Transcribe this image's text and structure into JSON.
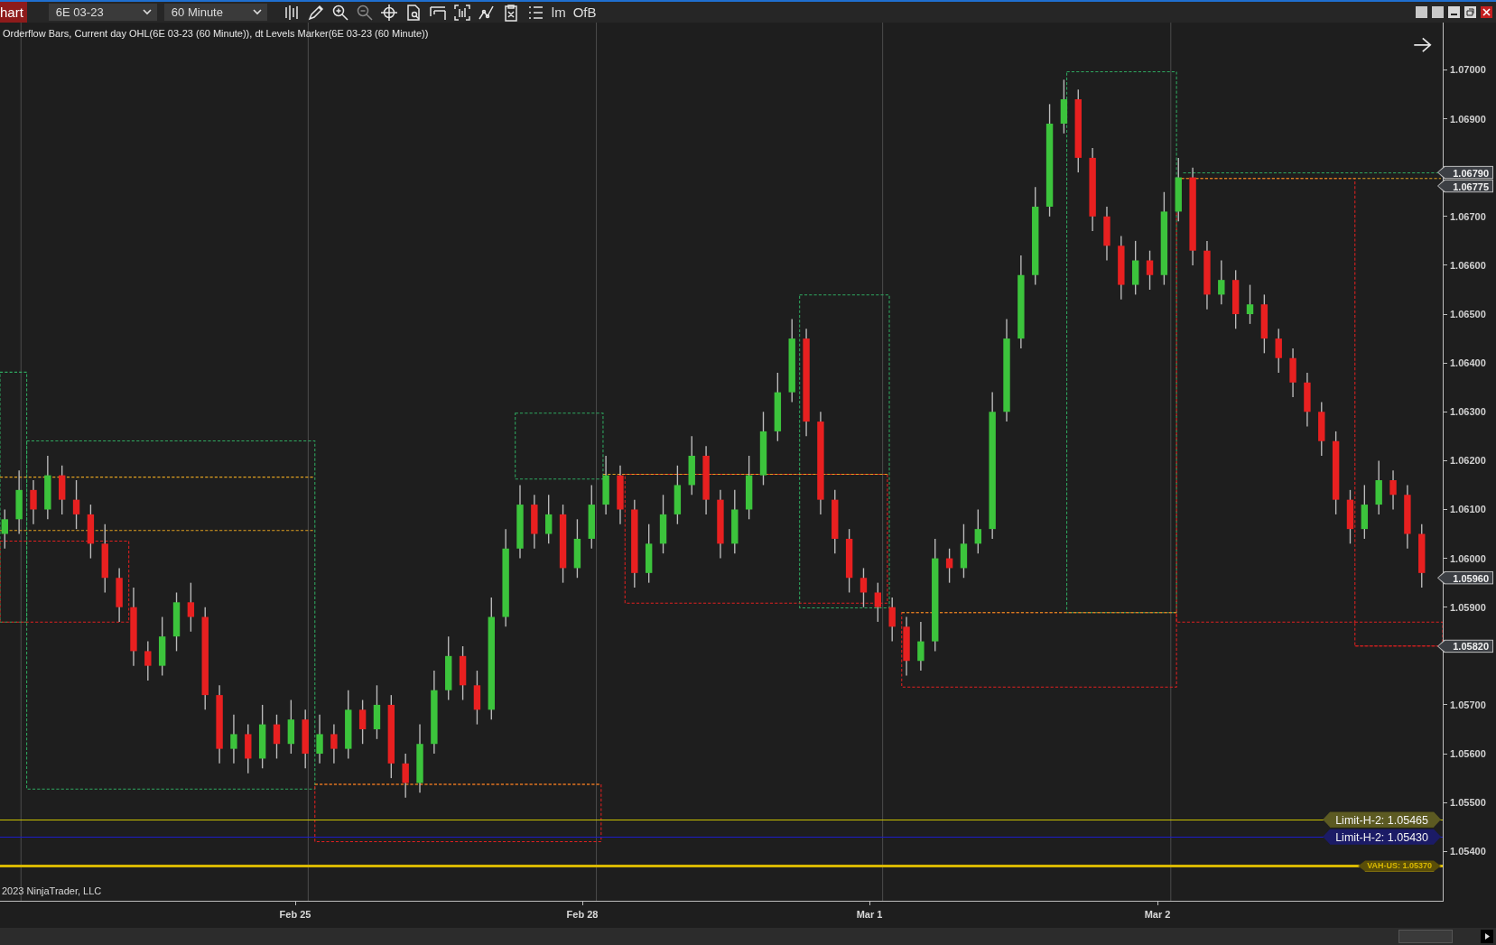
{
  "toolbar": {
    "tab_label": "hart",
    "instrument": {
      "value": "6E 03-23"
    },
    "interval": {
      "value": "60 Minute"
    },
    "text_tools": [
      "lm",
      "OfB"
    ]
  },
  "chart": {
    "title": "Orderflow Bars, Current day OHL(6E 03-23 (60 Minute)), dt Levels Marker(6E 03-23 (60 Minute))",
    "copyright": "2023 NinjaTrader, LLC",
    "price_markers": [
      {
        "label": "1.06790"
      },
      {
        "label": "1.06775"
      },
      {
        "label": "1.05960"
      },
      {
        "label": "1.05820"
      }
    ],
    "date_labels": [
      "Feb 25",
      "Feb 28",
      "Mar 1",
      "Mar 2"
    ],
    "level_lines": [
      {
        "label": "Limit-H-2: 1.05465",
        "color": "#c9c100",
        "kind": "limit"
      },
      {
        "label": "Limit-H-2: 1.05430",
        "color": "#1c1cc8",
        "kind": "limit"
      },
      {
        "label": "VAH-US: 1.05370",
        "color": "#d9b800",
        "kind": "value-area"
      }
    ],
    "chart_data": {
      "type": "candlestick",
      "ylim": [
        1.05297,
        1.07097
      ],
      "yticks": [
        {
          "value": 1.07,
          "label": "1.07000"
        },
        {
          "value": 1.069,
          "label": "1.06900"
        },
        {
          "value": 1.067,
          "label": "1.06700"
        },
        {
          "value": 1.066,
          "label": "1.06600"
        },
        {
          "value": 1.065,
          "label": "1.06500"
        },
        {
          "value": 1.064,
          "label": "1.06400"
        },
        {
          "value": 1.063,
          "label": "1.06300"
        },
        {
          "value": 1.062,
          "label": "1.06200"
        },
        {
          "value": 1.061,
          "label": "1.06100"
        },
        {
          "value": 1.06,
          "label": "1.06000"
        },
        {
          "value": 1.059,
          "label": "1.05900"
        },
        {
          "value": 1.057,
          "label": "1.05700"
        },
        {
          "value": 1.056,
          "label": "1.05600"
        },
        {
          "value": 1.055,
          "label": "1.05500"
        },
        {
          "value": 1.054,
          "label": "1.05400"
        }
      ],
      "categories": [
        null,
        null,
        null,
        null,
        null,
        null,
        null,
        null,
        null,
        null,
        null,
        null,
        null,
        null,
        null,
        null,
        null,
        null,
        null,
        null,
        null,
        null,
        null,
        null,
        null,
        null,
        null,
        null,
        null,
        null,
        null,
        null,
        null,
        null,
        null,
        null,
        null,
        null,
        null,
        null,
        null,
        null,
        null,
        null,
        null,
        null,
        null,
        null,
        null,
        null,
        null,
        null,
        null,
        null,
        null,
        null,
        null,
        null,
        null,
        null,
        null,
        null,
        null,
        null,
        null,
        null,
        null,
        null,
        null,
        null,
        null,
        null,
        null,
        null,
        null,
        null,
        null,
        null,
        null,
        null,
        null,
        null,
        null,
        null,
        null,
        null,
        null,
        null,
        null,
        null,
        null,
        null,
        null,
        null,
        null,
        null,
        null,
        null,
        null,
        null
      ],
      "ohlc": [
        [
          1.0605,
          1.061,
          1.0602,
          1.0608
        ],
        [
          1.0608,
          1.0618,
          1.0605,
          1.0614
        ],
        [
          1.0614,
          1.0616,
          1.0607,
          1.061
        ],
        [
          1.061,
          1.0621,
          1.0608,
          1.0617
        ],
        [
          1.0617,
          1.0619,
          1.0609,
          1.0612
        ],
        [
          1.0612,
          1.0616,
          1.0606,
          1.0609
        ],
        [
          1.0609,
          1.0611,
          1.06,
          1.0603
        ],
        [
          1.0603,
          1.0607,
          1.0593,
          1.0596
        ],
        [
          1.0596,
          1.0598,
          1.0587,
          1.059
        ],
        [
          1.059,
          1.0594,
          1.0578,
          1.0581
        ],
        [
          1.0581,
          1.0583,
          1.0575,
          1.0578
        ],
        [
          1.0578,
          1.0588,
          1.0576,
          1.0584
        ],
        [
          1.0584,
          1.0593,
          1.0581,
          1.0591
        ],
        [
          1.0591,
          1.0595,
          1.0585,
          1.0588
        ],
        [
          1.0588,
          1.059,
          1.0569,
          1.0572
        ],
        [
          1.0572,
          1.0574,
          1.0558,
          1.0561
        ],
        [
          1.0561,
          1.0568,
          1.0558,
          1.0564
        ],
        [
          1.0564,
          1.0566,
          1.0556,
          1.0559
        ],
        [
          1.0559,
          1.057,
          1.0557,
          1.0566
        ],
        [
          1.0566,
          1.0568,
          1.0559,
          1.0562
        ],
        [
          1.0562,
          1.0571,
          1.056,
          1.0567
        ],
        [
          1.0567,
          1.0569,
          1.0557,
          1.056
        ],
        [
          1.056,
          1.0568,
          1.0558,
          1.0564
        ],
        [
          1.0564,
          1.0566,
          1.0558,
          1.0561
        ],
        [
          1.0561,
          1.0573,
          1.0559,
          1.0569
        ],
        [
          1.0569,
          1.0571,
          1.0562,
          1.0565
        ],
        [
          1.0565,
          1.0574,
          1.0563,
          1.057
        ],
        [
          1.057,
          1.0572,
          1.0555,
          1.0558
        ],
        [
          1.0558,
          1.056,
          1.0551,
          1.0554
        ],
        [
          1.0554,
          1.0566,
          1.0552,
          1.0562
        ],
        [
          1.0562,
          1.0577,
          1.056,
          1.0573
        ],
        [
          1.0573,
          1.0584,
          1.0571,
          1.058
        ],
        [
          1.058,
          1.0582,
          1.0571,
          1.0574
        ],
        [
          1.0574,
          1.0577,
          1.0566,
          1.0569
        ],
        [
          1.0569,
          1.0592,
          1.0567,
          1.0588
        ],
        [
          1.0588,
          1.0606,
          1.0586,
          1.0602
        ],
        [
          1.0602,
          1.0615,
          1.06,
          1.0611
        ],
        [
          1.0611,
          1.0613,
          1.0602,
          1.0605
        ],
        [
          1.0605,
          1.0613,
          1.0603,
          1.0609
        ],
        [
          1.0609,
          1.0611,
          1.0595,
          1.0598
        ],
        [
          1.0598,
          1.0608,
          1.0596,
          1.0604
        ],
        [
          1.0604,
          1.0615,
          1.0602,
          1.0611
        ],
        [
          1.0611,
          1.0621,
          1.0609,
          1.0617
        ],
        [
          1.0617,
          1.0619,
          1.0607,
          1.061
        ],
        [
          1.061,
          1.0612,
          1.0594,
          1.0597
        ],
        [
          1.0597,
          1.0607,
          1.0595,
          1.0603
        ],
        [
          1.0603,
          1.0613,
          1.0601,
          1.0609
        ],
        [
          1.0609,
          1.0619,
          1.0607,
          1.0615
        ],
        [
          1.0615,
          1.0625,
          1.0613,
          1.0621
        ],
        [
          1.0621,
          1.0623,
          1.0609,
          1.0612
        ],
        [
          1.0612,
          1.0614,
          1.06,
          1.0603
        ],
        [
          1.0603,
          1.0614,
          1.0601,
          1.061
        ],
        [
          1.061,
          1.0621,
          1.0608,
          1.0617
        ],
        [
          1.0617,
          1.063,
          1.0615,
          1.0626
        ],
        [
          1.0626,
          1.0638,
          1.0624,
          1.0634
        ],
        [
          1.0634,
          1.0649,
          1.0632,
          1.0645
        ],
        [
          1.0645,
          1.0647,
          1.0625,
          1.0628
        ],
        [
          1.0628,
          1.063,
          1.0609,
          1.0612
        ],
        [
          1.0612,
          1.0614,
          1.0601,
          1.0604
        ],
        [
          1.0604,
          1.0606,
          1.0593,
          1.0596
        ],
        [
          1.0596,
          1.0598,
          1.059,
          1.0593
        ],
        [
          1.0593,
          1.0595,
          1.0587,
          1.059
        ],
        [
          1.059,
          1.0592,
          1.0583,
          1.0586
        ],
        [
          1.0586,
          1.0588,
          1.0576,
          1.0579
        ],
        [
          1.0579,
          1.0587,
          1.0577,
          1.0583
        ],
        [
          1.0583,
          1.0604,
          1.0581,
          1.06
        ],
        [
          1.06,
          1.0602,
          1.0595,
          1.0598
        ],
        [
          1.0598,
          1.0607,
          1.0596,
          1.0603
        ],
        [
          1.0603,
          1.061,
          1.0601,
          1.0606
        ],
        [
          1.0606,
          1.0634,
          1.0604,
          1.063
        ],
        [
          1.063,
          1.0649,
          1.0628,
          1.0645
        ],
        [
          1.0645,
          1.0662,
          1.0643,
          1.0658
        ],
        [
          1.0658,
          1.0676,
          1.0656,
          1.0672
        ],
        [
          1.0672,
          1.0693,
          1.067,
          1.0689
        ],
        [
          1.0689,
          1.0698,
          1.0687,
          1.0694
        ],
        [
          1.0694,
          1.0696,
          1.0679,
          1.0682
        ],
        [
          1.0682,
          1.0684,
          1.0667,
          1.067
        ],
        [
          1.067,
          1.0672,
          1.0661,
          1.0664
        ],
        [
          1.0664,
          1.0666,
          1.0653,
          1.0656
        ],
        [
          1.0656,
          1.0665,
          1.0654,
          1.0661
        ],
        [
          1.0661,
          1.0663,
          1.0655,
          1.0658
        ],
        [
          1.0658,
          1.0675,
          1.0656,
          1.0671
        ],
        [
          1.0671,
          1.0682,
          1.0669,
          1.0678
        ],
        [
          1.0678,
          1.068,
          1.066,
          1.0663
        ],
        [
          1.0663,
          1.0665,
          1.0651,
          1.0654
        ],
        [
          1.0654,
          1.0661,
          1.0652,
          1.0657
        ],
        [
          1.0657,
          1.0659,
          1.0647,
          1.065
        ],
        [
          1.065,
          1.0656,
          1.0648,
          1.0652
        ],
        [
          1.0652,
          1.0654,
          1.0642,
          1.0645
        ],
        [
          1.0645,
          1.0647,
          1.0638,
          1.0641
        ],
        [
          1.0641,
          1.0643,
          1.0633,
          1.0636
        ],
        [
          1.0636,
          1.0638,
          1.0627,
          1.063
        ],
        [
          1.063,
          1.0632,
          1.0621,
          1.0624
        ],
        [
          1.0624,
          1.0626,
          1.0609,
          1.0612
        ],
        [
          1.0612,
          1.0614,
          1.0603,
          1.0606
        ],
        [
          1.0606,
          1.0615,
          1.0604,
          1.0611
        ],
        [
          1.0611,
          1.062,
          1.0609,
          1.0616
        ],
        [
          1.0616,
          1.0618,
          1.061,
          1.0613
        ],
        [
          1.0613,
          1.0615,
          1.0602,
          1.0605
        ],
        [
          1.0605,
          1.0607,
          1.0594,
          1.0597
        ]
      ]
    }
  }
}
